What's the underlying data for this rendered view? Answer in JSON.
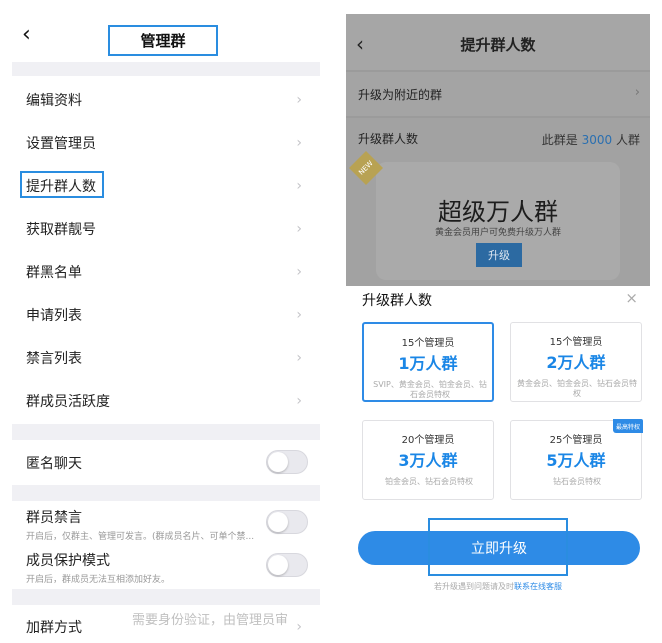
{
  "left": {
    "header": {
      "back_icon": "chevron-left-icon",
      "back_glyph": "‹",
      "title": "管理群"
    },
    "menu_items": [
      {
        "label": "编辑资料"
      },
      {
        "label": "设置管理员"
      },
      {
        "label": "提升群人数"
      },
      {
        "label": "获取群靓号"
      },
      {
        "label": "群黑名单"
      },
      {
        "label": "申请列表"
      },
      {
        "label": "禁言列表"
      },
      {
        "label": "群成员活跃度"
      }
    ],
    "chevron_glyph": "›",
    "anon_chat": {
      "label": "匿名聊天",
      "on": false
    },
    "member_mute": {
      "label": "群员禁言",
      "desc": "开启后，仅群主、管理可发言。(群成员名片、可单个禁...",
      "on": false
    },
    "protect_mode": {
      "label": "成员保护模式",
      "desc": "开启后，群成员无法互相添加好友。",
      "on": false
    },
    "join_method": {
      "label": "加群方式",
      "value": "需要身份验证，由管理员审"
    }
  },
  "right": {
    "header": {
      "back_glyph": "‹",
      "title": "提升群人数"
    },
    "nearby": {
      "label": "升级为附近的群",
      "chevron_glyph": "›"
    },
    "size_row": {
      "label": "升级群人数",
      "prefix": "此群是",
      "count": "3000",
      "suffix": "人群"
    },
    "new_tag": "NEW",
    "hero": {
      "title": "超级万人群",
      "subtitle": "黄金会员用户可免费升级万人群",
      "button": "升级"
    },
    "sheet": {
      "title": "升级群人数",
      "close_glyph": "×",
      "options": [
        {
          "admins": "15个管理员",
          "size": "1万人群",
          "perk": "SVIP、黄金会员、铂金会员、钻石会员特权",
          "selected": true,
          "badge": ""
        },
        {
          "admins": "15个管理员",
          "size": "2万人群",
          "perk": "黄金会员、铂金会员、钻石会员特权",
          "selected": false,
          "badge": ""
        },
        {
          "admins": "20个管理员",
          "size": "3万人群",
          "perk": "铂金会员、钻石会员特权",
          "selected": false,
          "badge": ""
        },
        {
          "admins": "25个管理员",
          "size": "5万人群",
          "perk": "钻石会员特权",
          "selected": false,
          "badge": "最高特权"
        }
      ],
      "cta": "立即升级",
      "help_text": "若升级遇到问题请及时",
      "help_link": "联系在线客服"
    }
  },
  "colors": {
    "accent": "#2e8be6",
    "highlight_box": "#2a8de0",
    "separator": "#f0f0f4"
  }
}
